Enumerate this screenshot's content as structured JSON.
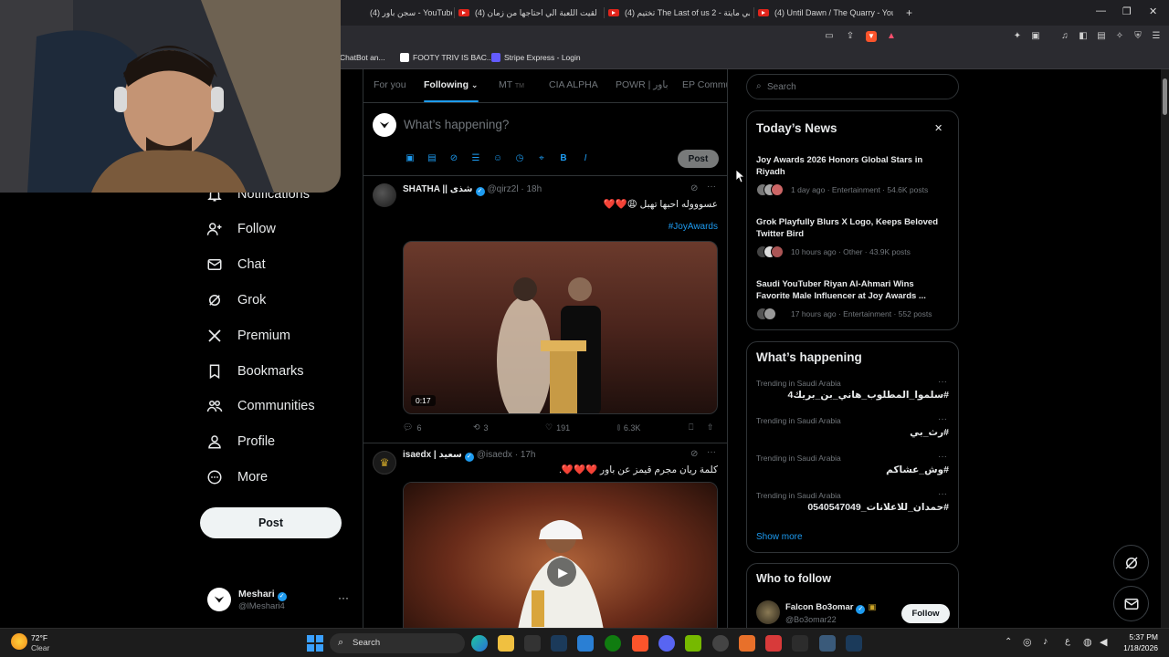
{
  "browser": {
    "tabs": [
      {
        "label": "(4) سجن باور - YouTube"
      },
      {
        "label": "(4) لقيت اللعبة الي احتاجها من زمان be"
      },
      {
        "label": "(4) تختيم The Last of us 2 - قلبي مايتة"
      },
      {
        "label": "(4) Until Dawn / The Quarry - YouTube"
      }
    ],
    "new_tab": "+",
    "bookmarks": [
      {
        "label": "ChatBot an..."
      },
      {
        "label": "FOOTY TRIV IS BAC..."
      },
      {
        "label": "Stripe Express - Login"
      }
    ]
  },
  "sidebar": {
    "items": [
      {
        "label": "Notifications"
      },
      {
        "label": "Follow"
      },
      {
        "label": "Chat"
      },
      {
        "label": "Grok"
      },
      {
        "label": "Premium"
      },
      {
        "label": "Bookmarks"
      },
      {
        "label": "Communities"
      },
      {
        "label": "Profile"
      },
      {
        "label": "More"
      }
    ],
    "post_button": "Post",
    "account": {
      "name": "Meshari",
      "handle": "@lMeshari4",
      "more": "···"
    }
  },
  "feed": {
    "tabs": [
      {
        "label": "For you"
      },
      {
        "label": "Following"
      },
      {
        "label": "MT"
      },
      {
        "label": "CIA ALPHA"
      },
      {
        "label": "POWR | باور"
      },
      {
        "label": "EP Commu"
      }
    ],
    "compose": {
      "placeholder": "What’s happening?",
      "post_label": "Post"
    },
    "tweets": [
      {
        "name": "SHATHA || شذى",
        "handle": "@qirz2l",
        "time": "18h",
        "text": "عسوووله احبها تهبل 😩❤️❤️",
        "hashtag": "#JoyAwards",
        "video_duration": "0:17",
        "replies": "6",
        "reposts": "3",
        "likes": "191",
        "views": "6.3K"
      },
      {
        "name": "isaedx | سعيد",
        "handle": "@isaedx",
        "time": "17h",
        "text": "كلمة ريان مجرم قيمز عن باور ❤️❤️❤️."
      }
    ]
  },
  "right": {
    "search_placeholder": "Search",
    "news": {
      "title": "Today’s News",
      "close": "✕",
      "items": [
        {
          "title": "Joy Awards 2026 Honors Global Stars in Riyadh",
          "meta": "1 day ago · Entertainment · 54.6K posts"
        },
        {
          "title": "Grok Playfully Blurs X Logo, Keeps Beloved Twitter Bird",
          "meta": "10 hours ago · Other · 43.9K posts"
        },
        {
          "title": "Saudi YouTuber Riyan Al-Ahmari Wins Favorite Male Influencer at Joy Awards ...",
          "meta": "17 hours ago · Entertainment · 552 posts"
        }
      ]
    },
    "happening": {
      "title": "What’s happening",
      "trends": [
        {
          "category": "Trending in Saudi Arabia",
          "name": "#سلموا_المطلوب_هاني_بن_بريك4"
        },
        {
          "category": "Trending in Saudi Arabia",
          "name": "#رث_بي"
        },
        {
          "category": "Trending in Saudi Arabia",
          "name": "#وش_عشاكم"
        },
        {
          "category": "Trending in Saudi Arabia",
          "name": "#حمدان_للاعلانات_0540547049"
        }
      ],
      "more_dots": "···",
      "show_more": "Show more"
    },
    "who_to_follow": {
      "title": "Who to follow",
      "user": {
        "name": "Falcon Bo3omar",
        "handle": "@Bo3omar22"
      },
      "follow_label": "Follow"
    }
  },
  "taskbar": {
    "weather_temp": "72°F",
    "weather_desc": "Clear",
    "search_label": "Search",
    "time": "5:37 PM",
    "date": "1/18/2026",
    "lang": "ع"
  },
  "colors": {
    "accent": "#1d9bf0",
    "background": "#000000",
    "muted": "#71767b"
  }
}
